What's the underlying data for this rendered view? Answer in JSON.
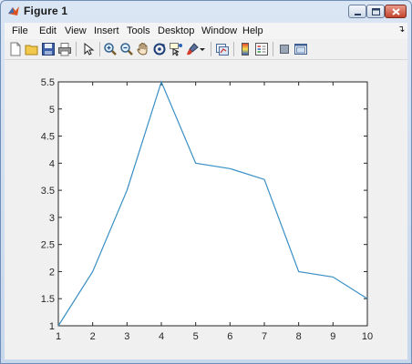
{
  "window": {
    "title": "Figure 1",
    "menu": [
      "File",
      "Edit",
      "View",
      "Insert",
      "Tools",
      "Desktop",
      "Window",
      "Help"
    ],
    "toolbar_icons": [
      "new-figure-icon",
      "open-file-icon",
      "save-icon",
      "print-icon",
      "select-arrow-icon",
      "zoom-in-icon",
      "zoom-out-icon",
      "pan-hand-icon",
      "rotate-3d-icon",
      "data-cursor-icon",
      "brush-icon",
      "brush-dropdown-icon",
      "link-plot-icon",
      "insert-colorbar-icon",
      "insert-legend-icon",
      "hide-plot-tools-icon",
      "show-plot-tools-icon"
    ]
  },
  "chart_data": {
    "type": "line",
    "x": [
      1,
      2,
      3,
      4,
      5,
      6,
      7,
      8,
      9,
      10
    ],
    "series": [
      {
        "values": [
          1,
          2,
          3.5,
          5.5,
          4,
          3.9,
          3.7,
          2,
          1.9,
          1.5
        ],
        "color": "#3a8fc4"
      }
    ],
    "xlim": [
      1,
      10
    ],
    "ylim": [
      1,
      5.5
    ],
    "xticks": [
      "1",
      "2",
      "3",
      "4",
      "5",
      "6",
      "7",
      "8",
      "9",
      "10"
    ],
    "yticks": [
      "1",
      "1.5",
      "2",
      "2.5",
      "3",
      "3.5",
      "4",
      "4.5",
      "5",
      "5.5"
    ],
    "grid": false,
    "title": "",
    "xlabel": "",
    "ylabel": ""
  }
}
